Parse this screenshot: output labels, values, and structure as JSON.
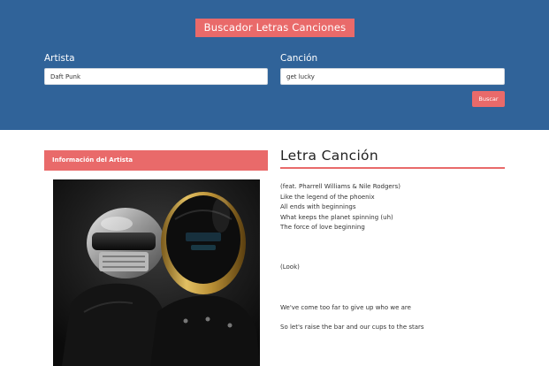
{
  "header": {
    "title": "Buscador Letras Canciones",
    "artist_label": "Artista",
    "song_label": "Canción",
    "artist_value": "Daft Punk",
    "song_value": "get lucky",
    "search_button": "Buscar"
  },
  "artist_panel": {
    "title": "Información del Artista"
  },
  "lyrics_panel": {
    "title": "Letra Canción",
    "lines": [
      "(feat. Pharrell Williams & Nile Rodgers)",
      "Like the legend of the phoenix",
      "All ends with beginnings",
      "What keeps the planet spinning (uh)",
      "The force of love beginning",
      "(Look)",
      "We've come too far to give up who we are",
      "So let's raise the bar and our cups to the stars"
    ]
  },
  "colors": {
    "header_bg": "#306399",
    "accent": "#e96a6a"
  }
}
